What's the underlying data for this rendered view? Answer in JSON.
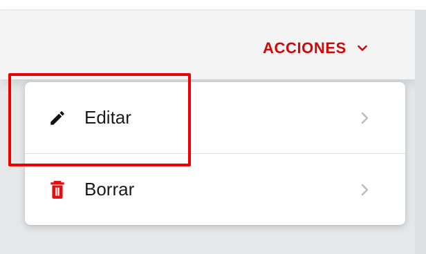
{
  "header": {
    "actions_label": "ACCIONES",
    "actions_icon": "chevron-down-icon"
  },
  "menu": {
    "items": [
      {
        "label": "Editar",
        "icon": "pencil-icon",
        "trailing_icon": "chevron-right-icon"
      },
      {
        "label": "Borrar",
        "icon": "trash-icon",
        "trailing_icon": "chevron-right-icon"
      }
    ]
  },
  "colors": {
    "accent": "#cc0a0a",
    "highlight": "#ee0000",
    "text": "#1a1a1a",
    "chevron": "#bdbdbd"
  }
}
